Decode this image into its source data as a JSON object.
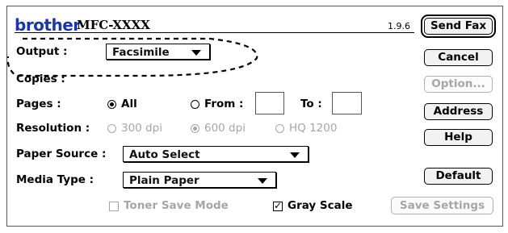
{
  "header": {
    "logo": "brother",
    "model": "MFC-XXXX",
    "version": "1.9.6"
  },
  "output": {
    "label": "Output :",
    "value": "Facsimile"
  },
  "copies": {
    "label": "Copies :"
  },
  "pages": {
    "label": "Pages :",
    "all_label": "All",
    "from_label": "From :",
    "to_label": "To :",
    "selected": "All"
  },
  "resolution": {
    "label": "Resolution :",
    "options": [
      "300 dpi",
      "600 dpi",
      "HQ 1200"
    ],
    "selected": "600 dpi"
  },
  "paper_source": {
    "label": "Paper Source :",
    "value": "Auto Select"
  },
  "media_type": {
    "label": "Media Type :",
    "value": "Plain Paper"
  },
  "toner_save": {
    "label": "Toner Save Mode",
    "checked": false
  },
  "gray_scale": {
    "label": "Gray Scale",
    "checked": true
  },
  "buttons": {
    "send_fax": "Send Fax",
    "cancel": "Cancel",
    "option": "Option...",
    "address": "Address",
    "help": "Help",
    "default": "Default",
    "save_settings": "Save Settings"
  },
  "colors": {
    "brand": "#1a38a5",
    "disabled_text": "#a6a6a6"
  }
}
